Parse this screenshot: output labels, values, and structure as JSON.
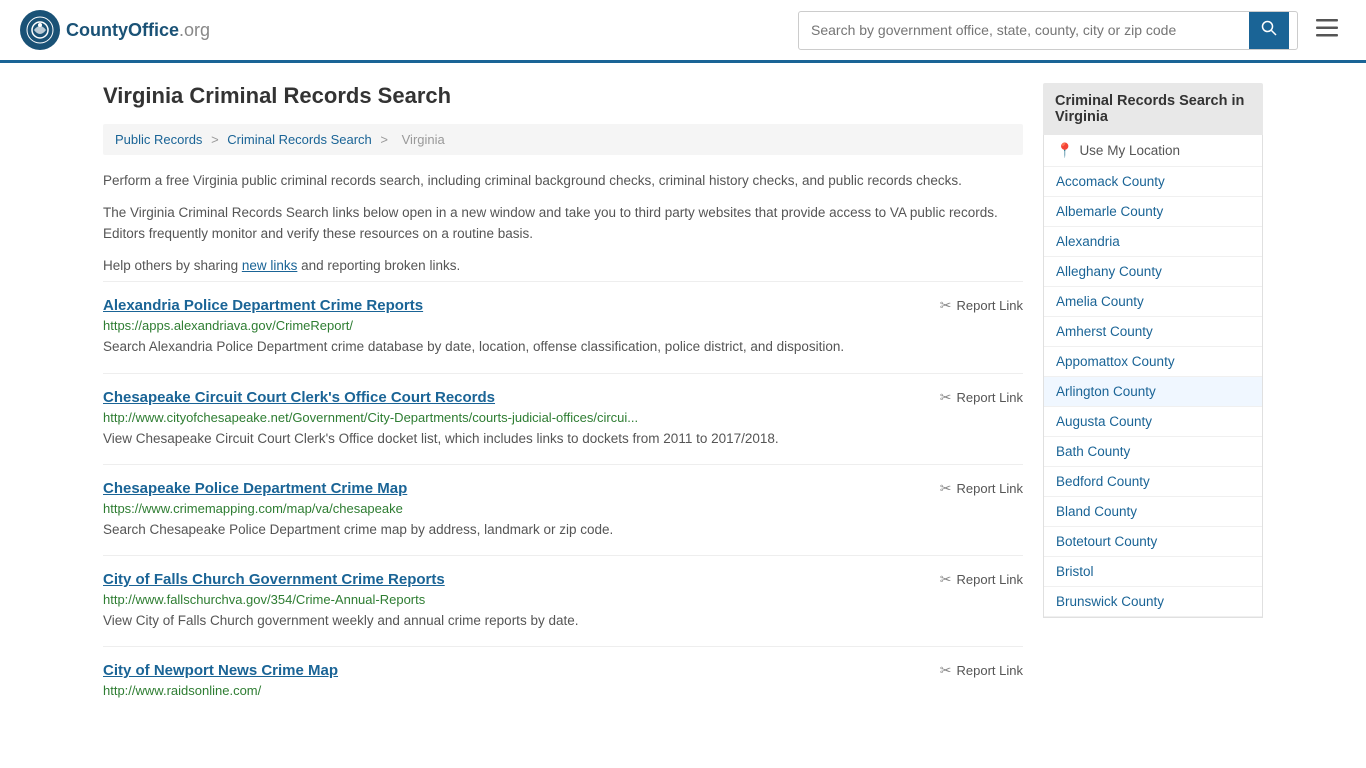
{
  "header": {
    "logo_text": "CountyOffice",
    "logo_tld": ".org",
    "search_placeholder": "Search by government office, state, county, city or zip code",
    "search_value": ""
  },
  "page": {
    "title": "Virginia Criminal Records Search",
    "breadcrumb": {
      "items": [
        "Public Records",
        "Criminal Records Search",
        "Virginia"
      ]
    },
    "description1": "Perform a free Virginia public criminal records search, including criminal background checks, criminal history checks, and public records checks.",
    "description2": "The Virginia Criminal Records Search links below open in a new window and take you to third party websites that provide access to VA public records. Editors frequently monitor and verify these resources on a routine basis.",
    "description3_prefix": "Help others by sharing ",
    "description3_link": "new links",
    "description3_suffix": " and reporting broken links.",
    "results": [
      {
        "title": "Alexandria Police Department Crime Reports",
        "url": "https://apps.alexandriava.gov/CrimeReport/",
        "desc": "Search Alexandria Police Department crime database by date, location, offense classification, police district, and disposition.",
        "report_label": "Report Link"
      },
      {
        "title": "Chesapeake Circuit Court Clerk's Office Court Records",
        "url": "http://www.cityofchesapeake.net/Government/City-Departments/courts-judicial-offices/circui...",
        "desc": "View Chesapeake Circuit Court Clerk's Office docket list, which includes links to dockets from 2011 to 2017/2018.",
        "report_label": "Report Link"
      },
      {
        "title": "Chesapeake Police Department Crime Map",
        "url": "https://www.crimemapping.com/map/va/chesapeake",
        "desc": "Search Chesapeake Police Department crime map by address, landmark or zip code.",
        "report_label": "Report Link"
      },
      {
        "title": "City of Falls Church Government Crime Reports",
        "url": "http://www.fallschurchva.gov/354/Crime-Annual-Reports",
        "desc": "View City of Falls Church government weekly and annual crime reports by date.",
        "report_label": "Report Link"
      },
      {
        "title": "City of Newport News Crime Map",
        "url": "http://www.raidsonline.com/",
        "desc": "",
        "report_label": "Report Link"
      }
    ]
  },
  "sidebar": {
    "title": "Criminal Records Search in Virginia",
    "location_label": "Use My Location",
    "items": [
      "Accomack County",
      "Albemarle County",
      "Alexandria",
      "Alleghany County",
      "Amelia County",
      "Amherst County",
      "Appomattox County",
      "Arlington County",
      "Augusta County",
      "Bath County",
      "Bedford County",
      "Bland County",
      "Botetourt County",
      "Bristol",
      "Brunswick County"
    ]
  }
}
